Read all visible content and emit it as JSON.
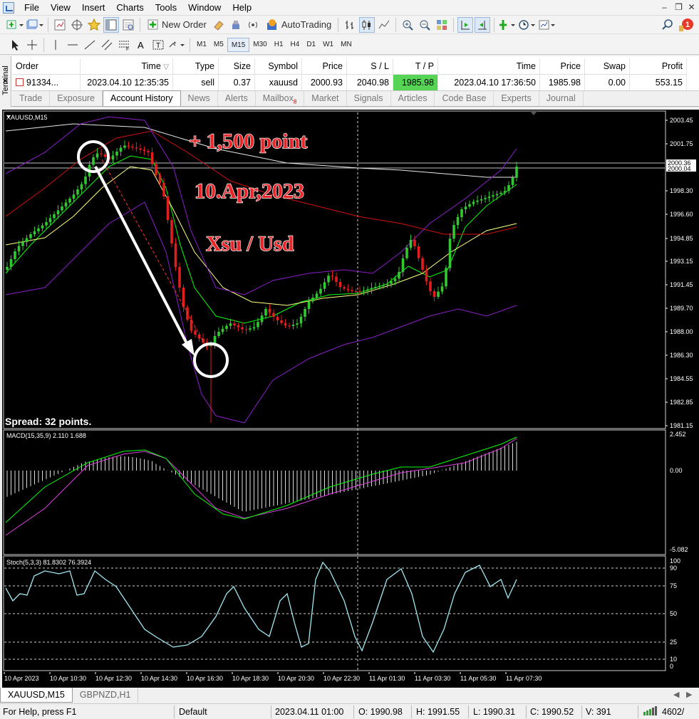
{
  "menu": [
    "File",
    "View",
    "Insert",
    "Charts",
    "Tools",
    "Window",
    "Help"
  ],
  "toolbar": {
    "new_order": "New Order",
    "autotrading": "AutoTrading",
    "timeframes": [
      "M1",
      "M5",
      "M15",
      "M30",
      "H1",
      "H4",
      "D1",
      "W1",
      "MN"
    ],
    "active_timeframe": "M15",
    "notification_count": "1"
  },
  "terminal": {
    "side_label": "Terminal",
    "headers": [
      "Order",
      "Time",
      "Type",
      "Size",
      "Symbol",
      "Price",
      "S / L",
      "T / P",
      "Time",
      "Price",
      "Swap",
      "Profit"
    ],
    "row": [
      "91334...",
      "2023.04.10 12:35:35",
      "sell",
      "0.37",
      "xauusd",
      "2000.93",
      "2040.98",
      "1985.98",
      "2023.04.10 17:36:50",
      "1985.98",
      "0.00",
      "553.15"
    ],
    "tabs": [
      "Trade",
      "Exposure",
      "Account History",
      "News",
      "Alerts",
      "Mailbox",
      "Market",
      "Signals",
      "Articles",
      "Code Base",
      "Experts",
      "Journal"
    ],
    "mailbox_count": "8",
    "active_tab": "Account History"
  },
  "chart": {
    "symbol_label": "XAUUSD,M15",
    "spread": "Spread: 32 points.",
    "annotations": [
      "+ 1,500 point",
      "10.Apr,2023",
      "Xsu / Usd"
    ],
    "price_ticks": [
      "2003.45",
      "2001.75",
      "1998.30",
      "1996.60",
      "1994.85",
      "1993.15",
      "1991.45",
      "1989.70",
      "1988.00",
      "1986.30",
      "1984.55",
      "1982.85",
      "1981.15"
    ],
    "price_tags": [
      "2000.36",
      "2000.04"
    ],
    "macd_label": "MACD(15,35,9) 2.110 1.688",
    "macd_ticks": [
      "2.452",
      "0.00",
      "-5.082"
    ],
    "stoch_label": "Stoch(5,3,3) 81.8302 76.3924",
    "stoch_ticks": [
      "100",
      "90",
      "75",
      "50",
      "25",
      "10",
      "0"
    ],
    "time_ticks": [
      "10 Apr 2023",
      "10 Apr 10:30",
      "10 Apr 12:30",
      "10 Apr 14:30",
      "10 Apr 16:30",
      "10 Apr 18:30",
      "10 Apr 20:30",
      "10 Apr 22:30",
      "11 Apr 01:30",
      "11 Apr 03:30",
      "11 Apr 05:30",
      "11 Apr 07:30"
    ],
    "colors": {
      "bull": "#32c832",
      "bear": "#e01e1e",
      "ma_fast": "#00ff00",
      "ma_slow": "#ffff80",
      "ma_red": "#d01010",
      "ma_white": "#e8e8e8",
      "bands": "#8a1ec8",
      "macd_signal": "#e040e0",
      "stoch": "#a0e8f0",
      "annotation": "#e8262a"
    }
  },
  "chart_tabs": [
    "XAUUSD,M15",
    "GBPNZD,H1"
  ],
  "status": {
    "help": "For Help, press F1",
    "profile": "Default",
    "datetime": "2023.04.11 01:00",
    "open": "O: 1990.98",
    "high": "H: 1991.55",
    "low": "L: 1990.31",
    "close": "C: 1990.52",
    "volume": "V: 391",
    "traffic": "4602/"
  }
}
